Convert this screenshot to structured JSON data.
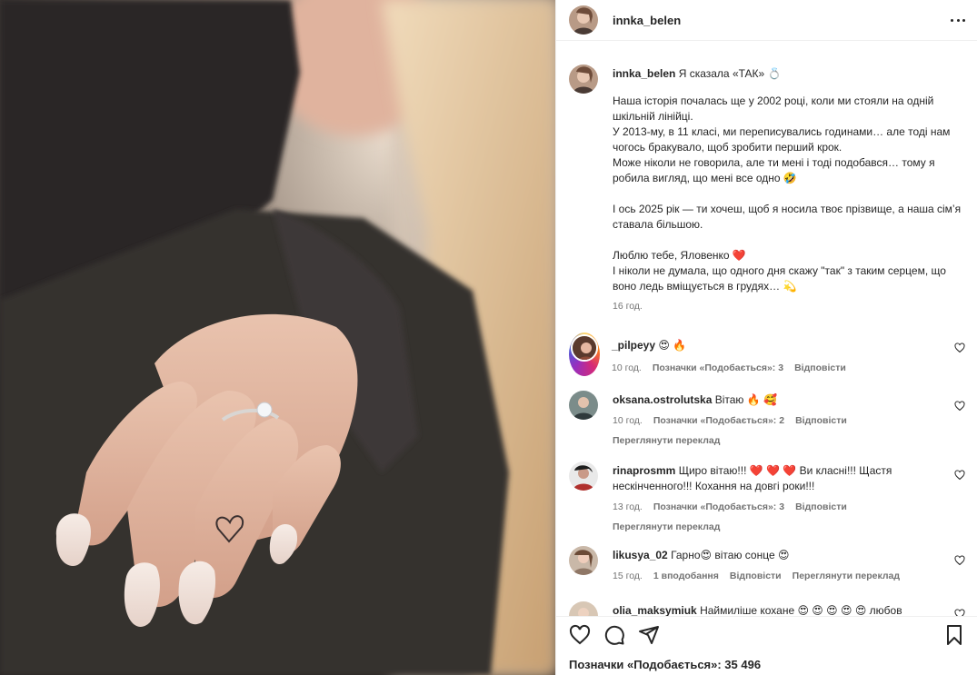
{
  "post": {
    "author": "innka_belen",
    "likes_text": "Позначки «Подобається»: 35 496"
  },
  "caption": {
    "username": "innka_belen",
    "headline": "Я сказала «ТАК» 💍",
    "paragraphs": [
      "Наша історія почалась ще у 2002 році, коли ми стояли на одній шкільній лінійці.\nУ 2013-му, в 11 класі, ми переписувались годинами… але тоді нам чогось бракувало, щоб зробити перший крок.\nМоже ніколи не говорила, але ти мені і тоді подобався… тому я робила вигляд, що мені все одно 🤣",
      "І ось 2025 рік — ти хочеш, щоб я носила твоє прізвище, а наша сім’я ставала більшою.",
      "Люблю тебе, Яловенко ❤️\nІ ніколи не думала, що одного дня скажу \"так\" з таким серцем, що воно ледь вміщується в грудях… 💫"
    ],
    "time": "16 год."
  },
  "comments": [
    {
      "username": "_pilpeyy",
      "text": "😍 🔥",
      "time": "10 год.",
      "likes": "Позначки «Подобається»: 3",
      "reply": "Відповісти",
      "translate": ""
    },
    {
      "username": "oksana.ostrolutska",
      "text": "Вітаю 🔥 🥰",
      "time": "10 год.",
      "likes": "Позначки «Подобається»: 2",
      "reply": "Відповісти",
      "translate": "Переглянути переклад"
    },
    {
      "username": "rinaprosmm",
      "text": "Щиро вітаю!!! ❤️ ❤️ ❤️  Ви класні!!! Щастя нескінченного!!! Кохання на довгі роки!!!",
      "time": "13 год.",
      "likes": "Позначки «Подобається»: 3",
      "reply": "Відповісти",
      "translate": "Переглянути переклад"
    },
    {
      "username": "likusya_02",
      "text": "Гарно😍 вітаю сонце 😍",
      "time": "15 год.",
      "likes": "1 вподобання",
      "reply": "Відповісти",
      "translate": "Переглянути переклад"
    },
    {
      "username": "olia_maksymiuk",
      "text": "Наймиліше кохане 😍 😍 😍 😍 😍 любов",
      "time": "",
      "likes": "",
      "reply": "",
      "translate": ""
    }
  ],
  "icons": {
    "more": "more-horizontal-icon",
    "like": "heart-icon",
    "comment": "comment-icon",
    "share": "share-icon",
    "save": "bookmark-icon",
    "comment_like": "heart-outline-icon"
  },
  "colors": {
    "text": "#262626",
    "muted": "#737373",
    "divider": "#efefef",
    "heart": "#ed4956"
  }
}
